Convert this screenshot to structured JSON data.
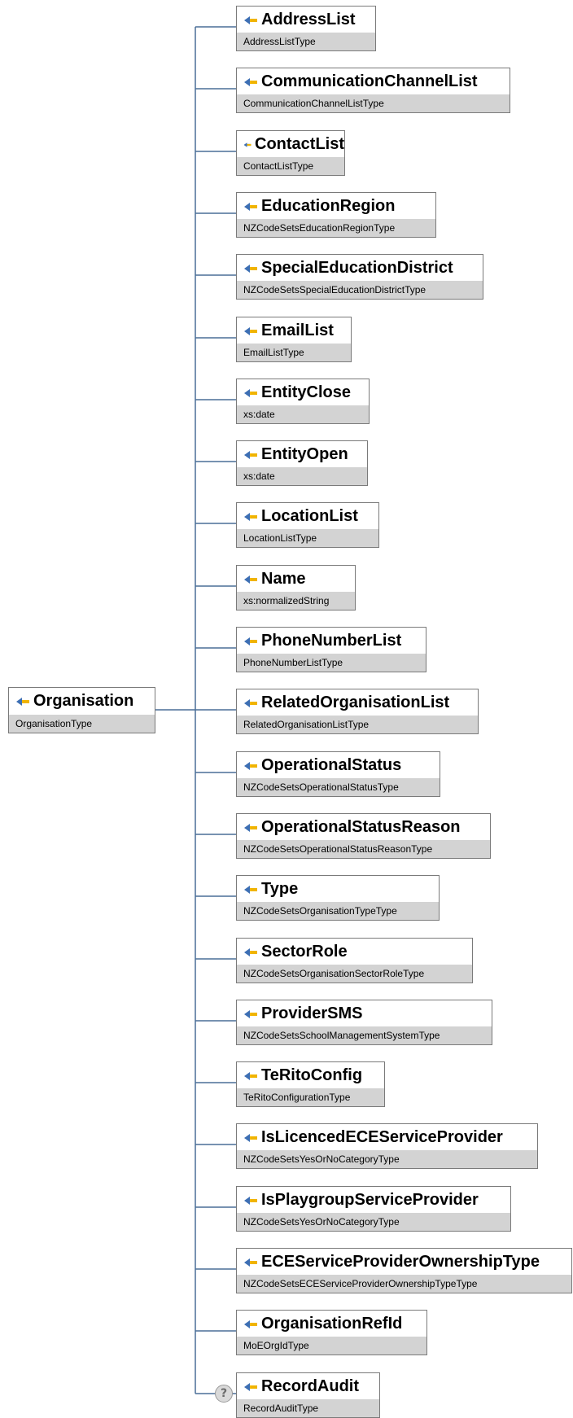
{
  "root": {
    "name": "Organisation",
    "type": "OrganisationType",
    "icon": "element-icon"
  },
  "children": [
    {
      "name": "AddressList",
      "type": "AddressListType"
    },
    {
      "name": "CommunicationChannelList",
      "type": "CommunicationChannelListType"
    },
    {
      "name": "ContactList",
      "type": "ContactListType"
    },
    {
      "name": "EducationRegion",
      "type": "NZCodeSetsEducationRegionType"
    },
    {
      "name": "SpecialEducationDistrict",
      "type": "NZCodeSetsSpecialEducationDistrictType"
    },
    {
      "name": "EmailList",
      "type": "EmailListType"
    },
    {
      "name": "EntityClose",
      "type": "xs:date"
    },
    {
      "name": "EntityOpen",
      "type": "xs:date"
    },
    {
      "name": "LocationList",
      "type": "LocationListType"
    },
    {
      "name": "Name",
      "type": "xs:normalizedString"
    },
    {
      "name": "PhoneNumberList",
      "type": "PhoneNumberListType"
    },
    {
      "name": "RelatedOrganisationList",
      "type": "RelatedOrganisationListType"
    },
    {
      "name": "OperationalStatus",
      "type": "NZCodeSetsOperationalStatusType"
    },
    {
      "name": "OperationalStatusReason",
      "type": "NZCodeSetsOperationalStatusReasonType"
    },
    {
      "name": "Type",
      "type": "NZCodeSetsOrganisationTypeType"
    },
    {
      "name": "SectorRole",
      "type": "NZCodeSetsOrganisationSectorRoleType"
    },
    {
      "name": "ProviderSMS",
      "type": "NZCodeSetsSchoolManagementSystemType"
    },
    {
      "name": "TeRitoConfig",
      "type": "TeRitoConfigurationType"
    },
    {
      "name": "IsLicencedECEServiceProvider",
      "type": "NZCodeSetsYesOrNoCategoryType"
    },
    {
      "name": "IsPlaygroupServiceProvider",
      "type": "NZCodeSetsYesOrNoCategoryType"
    },
    {
      "name": "ECEServiceProviderOwnershipType",
      "type": "NZCodeSetsECEServiceProviderOwnershipTypeType"
    },
    {
      "name": "OrganisationRefId",
      "type": "MoEOrgIdType"
    },
    {
      "name": "RecordAudit",
      "type": "RecordAuditType",
      "optional": true,
      "badge": "?"
    }
  ],
  "colors": {
    "wire": "#4a6f97",
    "icon_fill": "#3d6fb4",
    "icon_accent": "#f0b400",
    "type_band": "#d3d3d3"
  }
}
